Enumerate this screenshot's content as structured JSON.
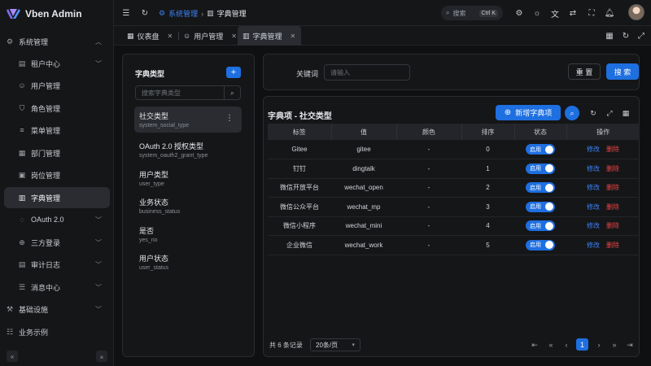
{
  "app": {
    "name": "Vben Admin"
  },
  "sidebar": {
    "items": [
      {
        "label": "系统管理",
        "icon": "gear-icon",
        "expanded": true
      },
      {
        "label": "租户中心",
        "icon": "building-icon",
        "sub": true,
        "chevron": true
      },
      {
        "label": "用户管理",
        "icon": "user-icon",
        "sub": true
      },
      {
        "label": "角色管理",
        "icon": "shield-icon",
        "sub": true
      },
      {
        "label": "菜单管理",
        "icon": "menu-icon",
        "sub": true
      },
      {
        "label": "部门管理",
        "icon": "org-icon",
        "sub": true
      },
      {
        "label": "岗位管理",
        "icon": "post-icon",
        "sub": true
      },
      {
        "label": "字典管理",
        "icon": "book-icon",
        "sub": true,
        "active": true
      },
      {
        "label": "OAuth 2.0",
        "icon": "oauth-icon",
        "sub": true,
        "chevron": true
      },
      {
        "label": "三方登录",
        "icon": "login-icon",
        "sub": true,
        "chevron": true
      },
      {
        "label": "审计日志",
        "icon": "log-icon",
        "sub": true,
        "chevron": true
      },
      {
        "label": "消息中心",
        "icon": "message-icon",
        "sub": true,
        "chevron": true
      },
      {
        "label": "基础设施",
        "icon": "infra-icon",
        "chevron": true
      },
      {
        "label": "业务示例",
        "icon": "list-icon"
      }
    ]
  },
  "breadcrumb": {
    "parent": "系统管理",
    "current": "字典管理"
  },
  "search": {
    "placeholder": "搜索",
    "shortcut": "Ctrl K"
  },
  "tabs": [
    {
      "label": "仪表盘",
      "icon": "dashboard-icon"
    },
    {
      "label": "用户管理",
      "icon": "user-icon"
    },
    {
      "label": "字典管理",
      "icon": "book-icon",
      "active": true
    }
  ],
  "dict_panel": {
    "title": "字典类型",
    "search_placeholder": "搜索字典类型",
    "types": [
      {
        "name": "社交类型",
        "code": "system_social_type",
        "active": true
      },
      {
        "name": "OAuth 2.0 授权类型",
        "code": "system_oauth2_grant_type"
      },
      {
        "name": "用户类型",
        "code": "user_type"
      },
      {
        "name": "业务状态",
        "code": "business_status"
      },
      {
        "name": "是否",
        "code": "yes_no"
      },
      {
        "name": "用户状态",
        "code": "user_status"
      }
    ]
  },
  "filter": {
    "label": "关键词",
    "placeholder": "请输入",
    "reset_label": "重 置",
    "search_label": "搜 索"
  },
  "table": {
    "title": "字典项 - 社交类型",
    "add_label": "新增字典项",
    "headers": [
      "标签",
      "值",
      "颜色",
      "排序",
      "状态",
      "操作"
    ],
    "rows": [
      {
        "label": "Gitee",
        "value": "gitee",
        "color": "-",
        "sort": "0",
        "status": "启用"
      },
      {
        "label": "钉钉",
        "value": "dingtalk",
        "color": "-",
        "sort": "1",
        "status": "启用"
      },
      {
        "label": "微信开放平台",
        "value": "wechat_open",
        "color": "-",
        "sort": "2",
        "status": "启用"
      },
      {
        "label": "微信公众平台",
        "value": "wechat_mp",
        "color": "-",
        "sort": "3",
        "status": "启用"
      },
      {
        "label": "微信小程序",
        "value": "wechat_mini",
        "color": "-",
        "sort": "4",
        "status": "启用"
      },
      {
        "label": "企业微信",
        "value": "wechat_work",
        "color": "-",
        "sort": "5",
        "status": "启用"
      }
    ],
    "edit_label": "修改",
    "delete_label": "删除"
  },
  "pagination": {
    "total_text": "共 6 条记录",
    "page_size": "20条/页",
    "current_page": "1"
  },
  "colors": {
    "accent": "#1e6fe0",
    "danger": "#ef4444",
    "bg": "#0f1012",
    "panel": "#151618"
  }
}
